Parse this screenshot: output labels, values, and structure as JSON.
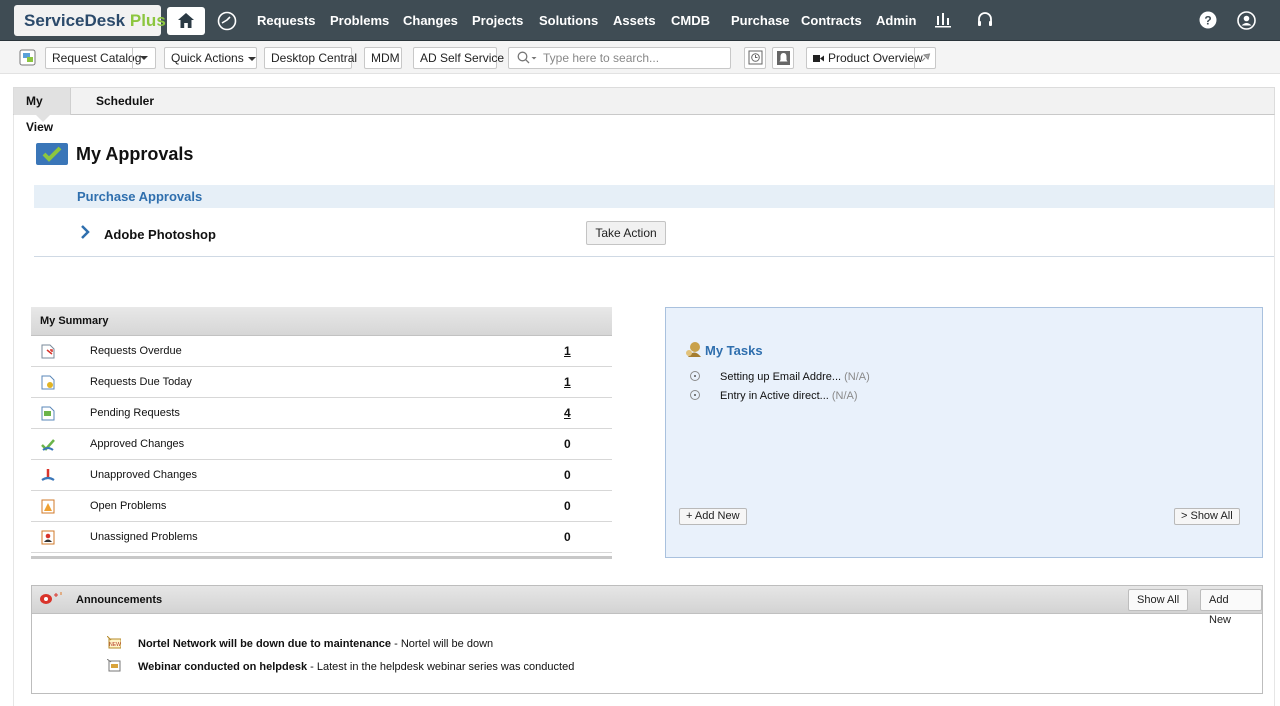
{
  "app": {
    "brand_main": "ServiceDesk",
    "brand_plus": "Plus"
  },
  "nav": [
    "Requests",
    "Problems",
    "Changes",
    "Projects",
    "Solutions",
    "Assets",
    "CMDB",
    "Purchase",
    "Contracts",
    "Admin"
  ],
  "toolbar": {
    "request_catalog": "Request Catalog",
    "quick_actions": "Quick Actions",
    "desktop_central": "Desktop Central",
    "mdm": "MDM",
    "ad_self_service": "AD Self Service",
    "search_placeholder": "Type here to search...",
    "product_overview": "Product Overview"
  },
  "tabs": [
    "My View",
    "Scheduler"
  ],
  "approvals": {
    "title": "My Approvals",
    "section": "Purchase Approvals",
    "item": "Adobe Photoshop",
    "action": "Take Action"
  },
  "summary": {
    "title": "My Summary",
    "rows": [
      {
        "label": "Requests Overdue",
        "count": "1",
        "icon": "requests-overdue-icon"
      },
      {
        "label": "Requests Due Today",
        "count": "1",
        "icon": "requests-due-today-icon"
      },
      {
        "label": "Pending Requests",
        "count": "4",
        "icon": "pending-requests-icon"
      },
      {
        "label": "Approved Changes",
        "count": "0",
        "icon": "approved-changes-icon"
      },
      {
        "label": "Unapproved Changes",
        "count": "0",
        "icon": "unapproved-changes-icon"
      },
      {
        "label": "Open Problems",
        "count": "0",
        "icon": "open-problems-icon"
      },
      {
        "label": "Unassigned Problems",
        "count": "0",
        "icon": "unassigned-problems-icon"
      }
    ]
  },
  "tasks": {
    "title": "My Tasks",
    "items": [
      {
        "text": "Setting up Email Addre...",
        "status": "(N/A)"
      },
      {
        "text": "Entry in Active direct...",
        "status": "(N/A)"
      }
    ],
    "add_new": "+ Add New",
    "show_all": "> Show All"
  },
  "announcements": {
    "title": "Announcements",
    "show_all": "Show All",
    "add_new": "Add New",
    "items": [
      {
        "title": "Nortel Network will be down due to maintenance",
        "desc": " - Nortel will be down"
      },
      {
        "title": "Webinar conducted on helpdesk",
        "desc": " - Latest in the helpdesk webinar series was conducted"
      }
    ]
  },
  "colors": {
    "nav_bg": "#3f4c54",
    "accent_blue": "#2f6fae",
    "brand_green": "#8cc63f"
  }
}
